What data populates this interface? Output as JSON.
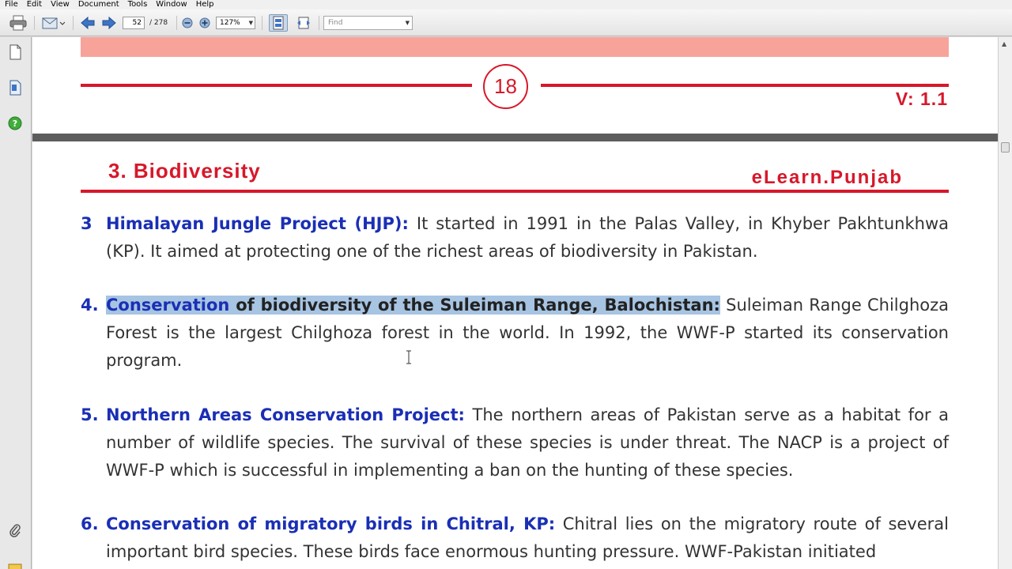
{
  "menubar": {
    "items": [
      "File",
      "Edit",
      "View",
      "Document",
      "Tools",
      "Window",
      "Help"
    ]
  },
  "toolbar": {
    "page_current": "52",
    "page_total": "/ 278",
    "zoom": "127%",
    "find_placeholder": "Find"
  },
  "icons": {
    "print": "print-icon",
    "email": "envelope-icon",
    "prev": "arrow-left-icon",
    "next": "arrow-right-icon",
    "zoom_out": "zoom-out-icon",
    "zoom_in": "zoom-in-icon",
    "fit_page": "fit-page-icon",
    "fit_width": "fit-width-icon",
    "pages": "pages-icon",
    "bookmarks": "bookmarks-icon",
    "help": "help-icon",
    "attachment": "paperclip-icon"
  },
  "colors": {
    "accent_red": "#d7182a",
    "heading_blue": "#1a2fb5",
    "highlight": "#a7c4e2",
    "banner_pink": "#f7a39a"
  },
  "prev_page": {
    "page_number": "18",
    "version": "V: 1.1"
  },
  "page": {
    "chapter_title": "3. Biodiversity",
    "brand": "eLearn.Punjab",
    "items": [
      {
        "number": "3",
        "heading": "Himalayan Jungle Project (HJP):",
        "body": " It started in 1991 in the Palas Valley, in Khyber Pakhtunkhwa (KP). It aimed at protecting one of the richest areas of biodiversity in Pakistan."
      },
      {
        "number": "4.",
        "heading_hl_blue": "Conservation",
        "heading_hl_dark": " of biodiversity of the Suleiman Range, Balochistan:",
        "body": " Suleiman Range Chilghoza Forest is the largest Chilghoza forest in the world. In 1992, the WWF-P started its conservation program."
      },
      {
        "number": "5.",
        "heading": "Northern Areas Conservation Project:",
        "body": " The northern areas of Pakistan serve as a habitat for a number of wildlife species. The survival of these species is under threat. The NACP is a project of  WWF-P which is successful in implementing a ban on the hunting of these species."
      },
      {
        "number": "6.",
        "heading": "Conservation of migratory birds in Chitral, KP:",
        "body": " Chitral lies on the migratory route of several important bird species. These birds face enormous hunting pressure. WWF-Pakistan initiated"
      }
    ]
  }
}
